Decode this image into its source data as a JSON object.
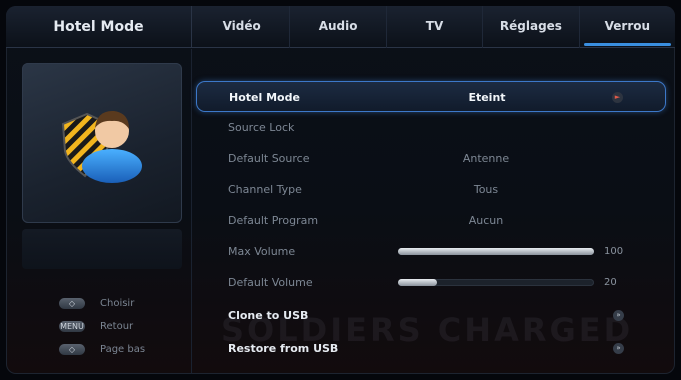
{
  "app": {
    "title": "Hotel Mode"
  },
  "tabs": [
    {
      "label": "Vidéo",
      "active": false
    },
    {
      "label": "Audio",
      "active": false
    },
    {
      "label": "TV",
      "active": false
    },
    {
      "label": "Réglages",
      "active": false
    },
    {
      "label": "Verrou",
      "active": true
    }
  ],
  "hints": [
    {
      "key": "◇",
      "label": "Choisir"
    },
    {
      "key": "MENU",
      "label": "Retour"
    },
    {
      "key": "◇",
      "label": "Page bas"
    }
  ],
  "menu": [
    {
      "label": "Hotel Mode",
      "value": "Eteint",
      "type": "option",
      "selected": true
    },
    {
      "label": "Source Lock",
      "value": "",
      "type": "option"
    },
    {
      "label": "Default Source",
      "value": "Antenne",
      "type": "option"
    },
    {
      "label": "Channel Type",
      "value": "Tous",
      "type": "option"
    },
    {
      "label": "Default Program",
      "value": "Aucun",
      "type": "option"
    },
    {
      "label": "Max Volume",
      "value": "100",
      "type": "slider",
      "level": 100
    },
    {
      "label": "Default Volume",
      "value": "20",
      "type": "slider",
      "level": 20
    },
    {
      "label": "Clone to USB",
      "value": "",
      "type": "action"
    },
    {
      "label": "Restore from USB",
      "value": "",
      "type": "action"
    }
  ],
  "colors": {
    "accent": "#3a8fe0",
    "selection_border": "#3c78c9"
  },
  "icons": {
    "user": "user-shield-icon",
    "arrow": "arrow-right-icon"
  }
}
